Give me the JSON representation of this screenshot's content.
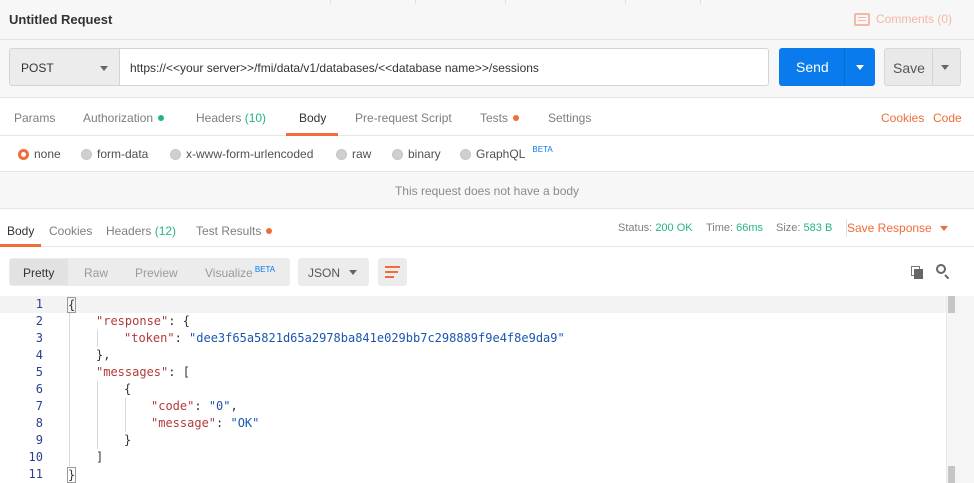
{
  "header": {
    "title": "Untitled Request",
    "comments_label": "Comments (0)"
  },
  "request": {
    "method": "POST",
    "url": "https://<<your server>>/fmi/data/v1/databases/<<database name>>/sessions",
    "send_label": "Send",
    "save_label": "Save"
  },
  "request_tabs": {
    "params": "Params",
    "authorization": "Authorization",
    "headers": "Headers",
    "headers_count": "(10)",
    "body": "Body",
    "pre_request": "Pre-request Script",
    "tests": "Tests",
    "settings": "Settings",
    "cookies": "Cookies",
    "code": "Code"
  },
  "body_types": {
    "none": "none",
    "form_data": "form-data",
    "urlencoded": "x-www-form-urlencoded",
    "raw": "raw",
    "binary": "binary",
    "graphql": "GraphQL",
    "graphql_badge": "BETA",
    "selected": "none"
  },
  "no_body_message": "This request does not have a body",
  "response_tabs": {
    "body": "Body",
    "cookies": "Cookies",
    "headers": "Headers",
    "headers_count": "(12)",
    "test_results": "Test Results"
  },
  "response_status": {
    "status_label": "Status:",
    "status_value": "200 OK",
    "time_label": "Time:",
    "time_value": "66ms",
    "size_label": "Size:",
    "size_value": "583 B",
    "save_response": "Save Response"
  },
  "view_options": {
    "pretty": "Pretty",
    "raw": "Raw",
    "preview": "Preview",
    "visualize": "Visualize",
    "visualize_badge": "BETA",
    "format": "JSON"
  },
  "code": {
    "line_numbers": [
      "1",
      "2",
      "3",
      "4",
      "5",
      "6",
      "7",
      "8",
      "9",
      "10",
      "11"
    ],
    "open_brace": "{",
    "close_brace": "}",
    "response_key": "\"response\"",
    "token_key": "\"token\"",
    "token_value": "\"dee3f65a5821d65a2978ba841e029bb7c298889f9e4f8e9da9\"",
    "messages_key": "\"messages\"",
    "code_key": "\"code\"",
    "code_value": "\"0\"",
    "message_key": "\"message\"",
    "message_value": "\"OK\""
  },
  "colors": {
    "accent": "#f26b3a",
    "primary": "#097bed",
    "success": "#26b47f"
  }
}
